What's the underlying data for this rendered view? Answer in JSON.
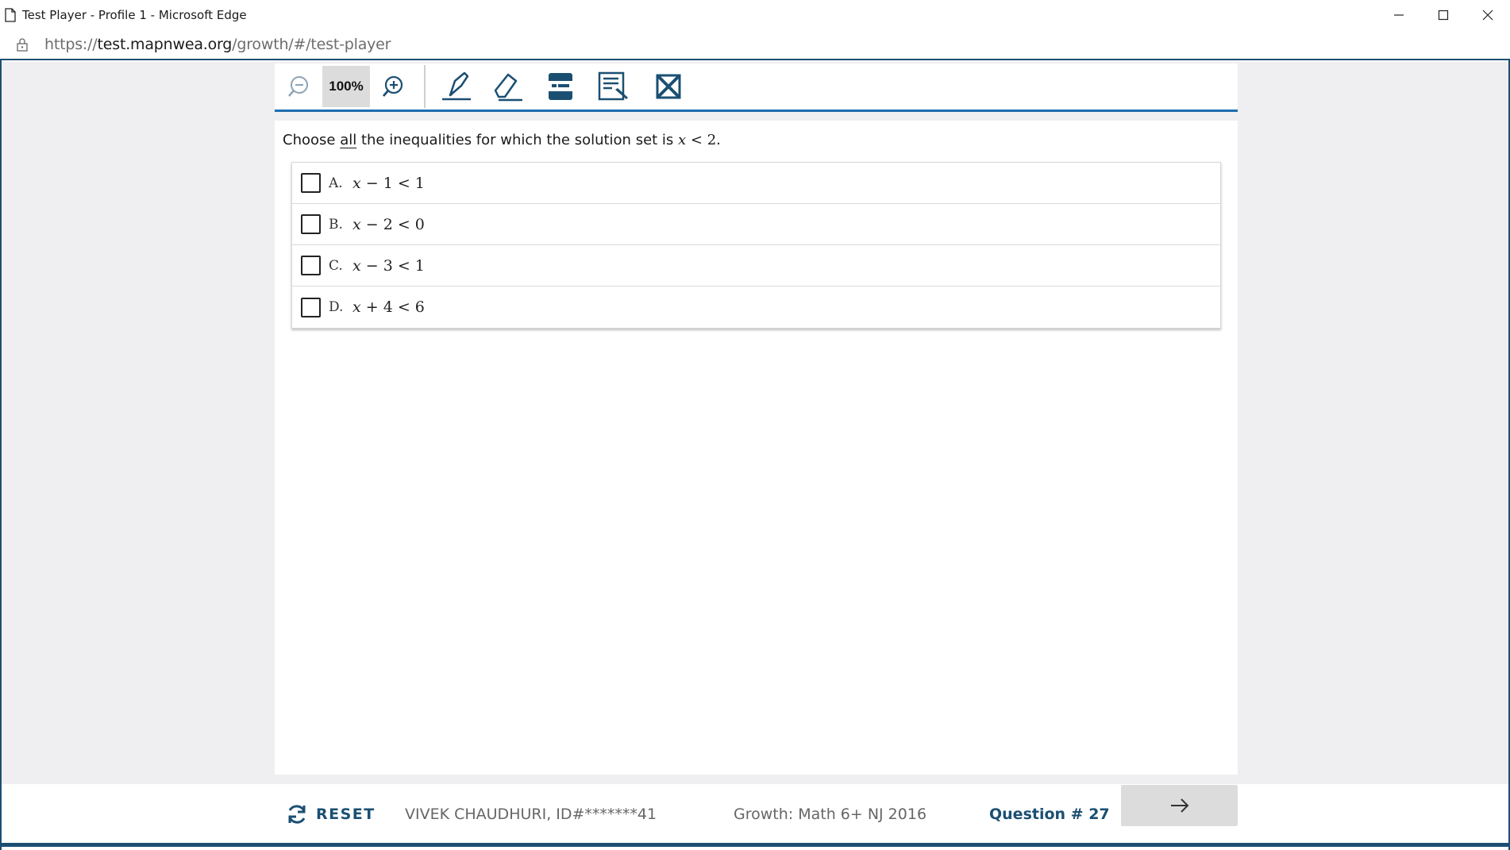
{
  "window": {
    "title": "Test Player - Profile 1 - Microsoft Edge"
  },
  "address": {
    "protocol": "https://",
    "host": "test.mapnwea.org",
    "path": "/growth/#/test-player"
  },
  "toolbar": {
    "zoom_level": "100%",
    "tools": [
      "zoom-out-icon",
      "zoom-in-icon",
      "highlighter-icon",
      "eraser-icon",
      "line-reader-icon",
      "notepad-icon",
      "answer-eliminator-icon"
    ]
  },
  "question": {
    "prompt_before": "Choose ",
    "prompt_emphasis": "all",
    "prompt_after": " the inequalities for which the solution set is ",
    "prompt_math_var": "x",
    "prompt_math_rest": " < 2",
    "prompt_end": "."
  },
  "choices": [
    {
      "letter": "A.",
      "var": "x",
      "rest": " − 1 < 1",
      "checked": false
    },
    {
      "letter": "B.",
      "var": "x",
      "rest": " − 2 < 0",
      "checked": false
    },
    {
      "letter": "C.",
      "var": "x",
      "rest": " − 3 < 1",
      "checked": false
    },
    {
      "letter": "D.",
      "var": "x",
      "rest": " + 4 < 6",
      "checked": false
    }
  ],
  "footer": {
    "reset_label": "RESET",
    "student": "VIVEK CHAUDHURI, ID#*******41",
    "test_name": "Growth: Math 6+ NJ 2016",
    "question_number": "Question # 27"
  },
  "colors": {
    "accent": "#1b4f72",
    "toolbar_rule": "#1d6eb0",
    "background": "#efeff1"
  }
}
